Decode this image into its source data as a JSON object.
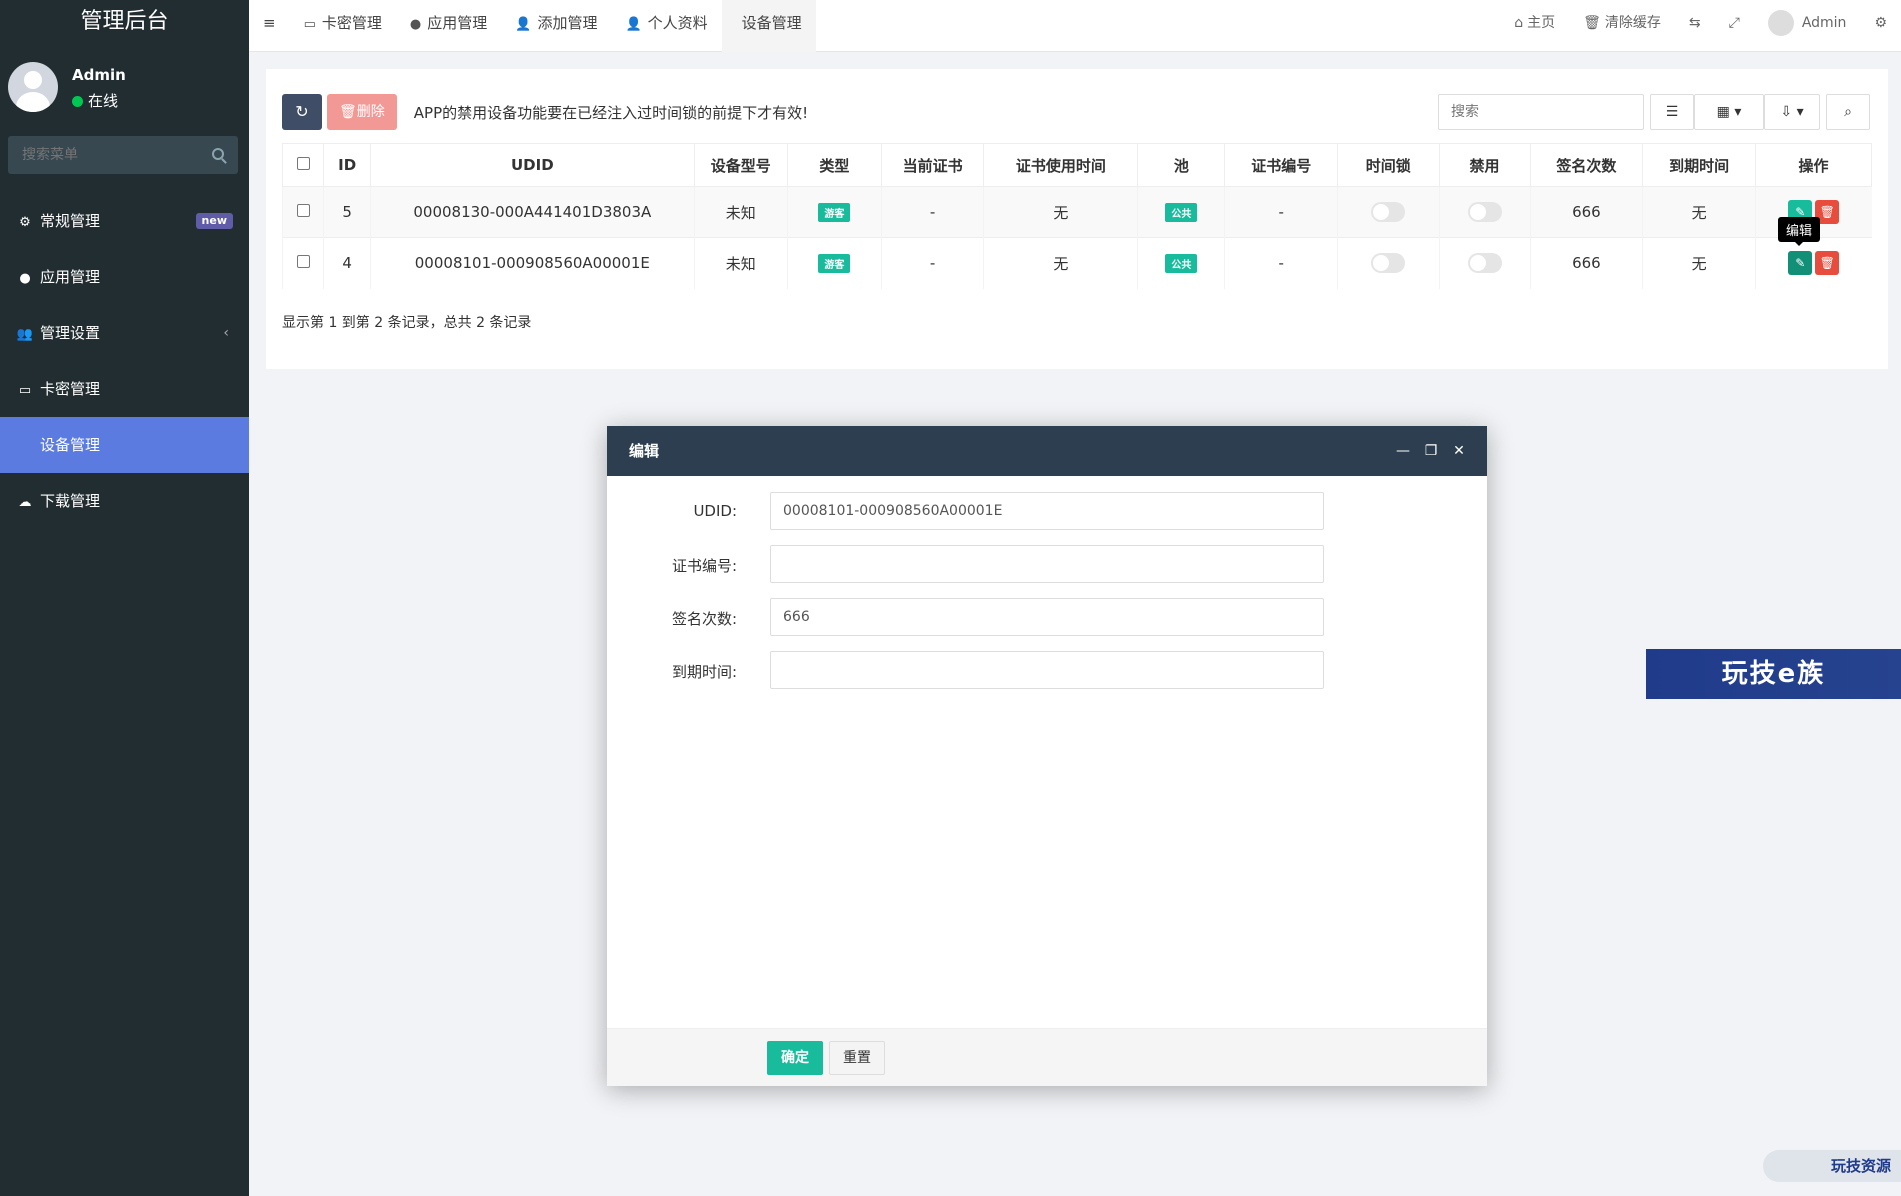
{
  "sidebar": {
    "brand": "管理后台",
    "user": {
      "name": "Admin",
      "status": "在线"
    },
    "search_placeholder": "搜索菜单",
    "items": [
      {
        "label": "常规管理",
        "badge": "new"
      },
      {
        "label": "应用管理"
      },
      {
        "label": "管理设置",
        "caret": "‹"
      },
      {
        "label": "卡密管理"
      },
      {
        "label": "设备管理",
        "active": true
      },
      {
        "label": "下载管理"
      }
    ]
  },
  "topbar": {
    "menu_icon": "≡",
    "nav": [
      "卡密管理",
      "应用管理",
      "添加管理",
      "个人资料",
      "设备管理"
    ],
    "right": {
      "home": "主页",
      "clear_cache": "清除缓存",
      "user": "Admin"
    }
  },
  "toolbar": {
    "delete_label": "删除",
    "notice": "APP的禁用设备功能要在已经注入过时间锁的前提下才有效!",
    "search_placeholder": "搜索"
  },
  "table": {
    "headers": [
      "ID",
      "UDID",
      "设备型号",
      "类型",
      "当前证书",
      "证书使用时间",
      "池",
      "证书编号",
      "时间锁",
      "禁用",
      "签名次数",
      "到期时间",
      "操作"
    ],
    "rows": [
      {
        "id": "5",
        "udid": "00008130-000A441401D3803A",
        "model": "未知",
        "type": "游客",
        "cert": "-",
        "cert_time": "无",
        "pool": "公共",
        "cert_no": "-",
        "sign_count": "666",
        "expire": "无"
      },
      {
        "id": "4",
        "udid": "00008101-000908560A00001E",
        "model": "未知",
        "type": "游客",
        "cert": "-",
        "cert_time": "无",
        "pool": "公共",
        "cert_no": "-",
        "sign_count": "666",
        "expire": "无"
      }
    ],
    "tooltip": "编辑",
    "pager": "显示第 1 到第 2 条记录，总共 2 条记录"
  },
  "modal": {
    "title": "编辑",
    "fields": [
      {
        "label": "UDID:",
        "value": "00008101-000908560A00001E"
      },
      {
        "label": "证书编号:",
        "value": ""
      },
      {
        "label": "签名次数:",
        "value": "666"
      },
      {
        "label": "到期时间:",
        "value": ""
      }
    ],
    "ok_label": "确定",
    "reset_label": "重置"
  },
  "watermarks": {
    "banner": "玩技e族",
    "corner": "玩技资源"
  },
  "colors": {
    "sidebar_bg": "#222d32",
    "active_menu": "#5b7be0",
    "modal_header": "#2c3e50",
    "primary_green": "#18bc9c",
    "danger": "#e74c3c"
  }
}
